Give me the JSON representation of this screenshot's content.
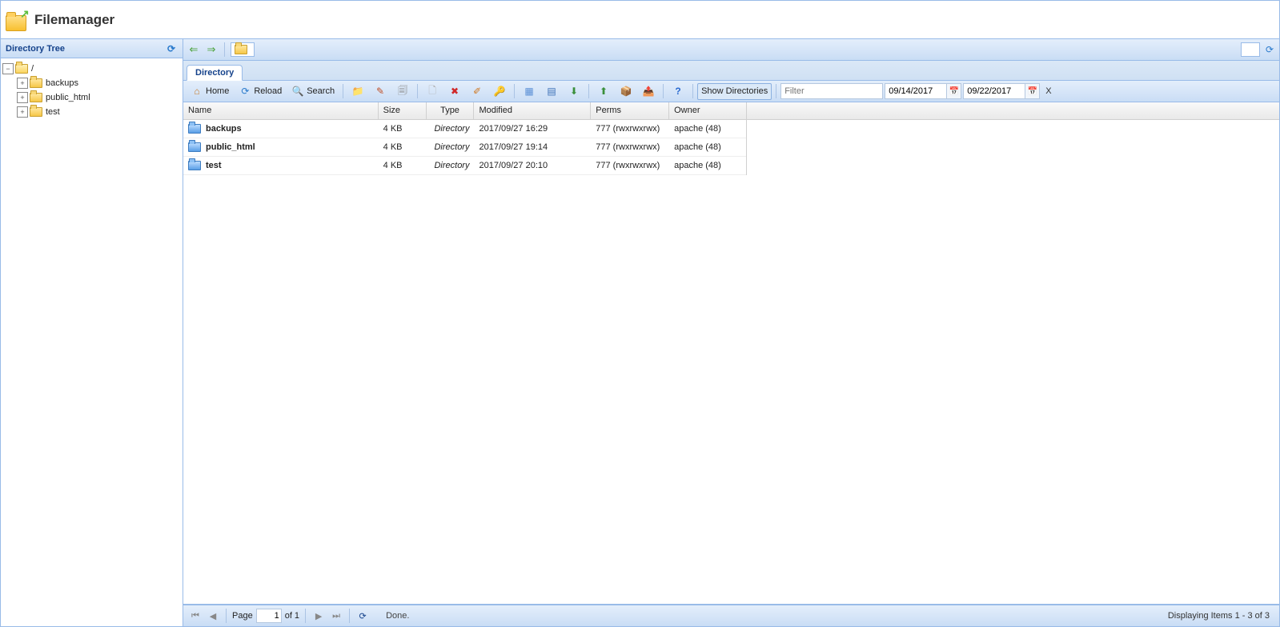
{
  "header": {
    "title": "Filemanager"
  },
  "sidebar": {
    "title": "Directory Tree",
    "root_label": "/",
    "nodes": [
      {
        "label": "backups"
      },
      {
        "label": "public_html"
      },
      {
        "label": "test"
      }
    ]
  },
  "tabs": {
    "active": "Directory"
  },
  "toolbar": {
    "home": "Home",
    "reload": "Reload",
    "search": "Search",
    "show_dirs": "Show Directories",
    "filter_placeholder": "Filter",
    "date_from": "09/14/2017",
    "date_to": "09/22/2017",
    "clear": "X"
  },
  "grid": {
    "columns": {
      "name": "Name",
      "size": "Size",
      "type": "Type",
      "modified": "Modified",
      "perms": "Perms",
      "owner": "Owner"
    },
    "rows": [
      {
        "name": "backups",
        "size": "4 KB",
        "type": "Directory",
        "modified": "2017/09/27 16:29",
        "perms": "777 (rwxrwxrwx)",
        "owner": "apache (48)"
      },
      {
        "name": "public_html",
        "size": "4 KB",
        "type": "Directory",
        "modified": "2017/09/27 19:14",
        "perms": "777 (rwxrwxrwx)",
        "owner": "apache (48)"
      },
      {
        "name": "test",
        "size": "4 KB",
        "type": "Directory",
        "modified": "2017/09/27 20:10",
        "perms": "777 (rwxrwxrwx)",
        "owner": "apache (48)"
      }
    ]
  },
  "pager": {
    "page_label": "Page",
    "page": "1",
    "of_label": "of 1",
    "done": "Done.",
    "status": "Displaying Items 1 - 3 of 3"
  }
}
